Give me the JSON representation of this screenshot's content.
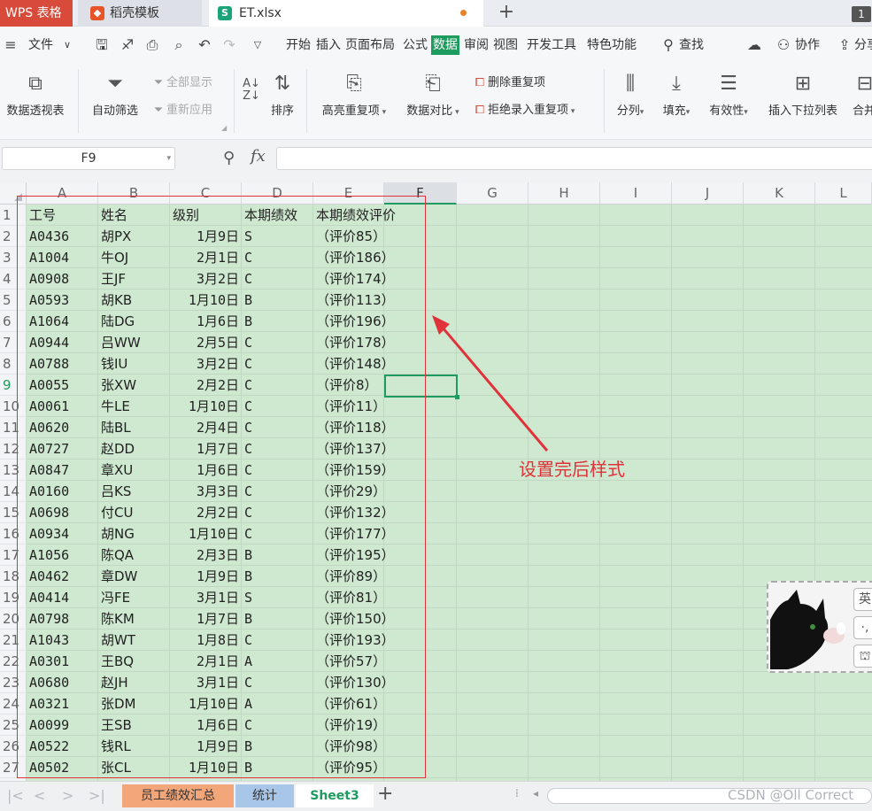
{
  "title_bar": {
    "wps_tab": "WPS 表格",
    "template_tab": "稻壳模板",
    "file_tab": "ET.xlsx",
    "window_count": "1"
  },
  "menu": {
    "file": "文件",
    "tabs": [
      "开始",
      "插入",
      "页面布局",
      "公式",
      "数据",
      "审阅",
      "视图",
      "开发工具",
      "特色功能"
    ],
    "active_tab": "数据",
    "search": "查找",
    "collab": "协作",
    "share": "分享"
  },
  "ribbon": {
    "pivot": "数据透视表",
    "autofilter": "自动筛选",
    "show_all": "全部显示",
    "reapply": "重新应用",
    "sort": "排序",
    "highlight_dup": "高亮重复项",
    "compare": "数据对比",
    "delete_dup": "删除重复项",
    "reject_dup": "拒绝录入重复项",
    "split": "分列",
    "fill": "填充",
    "validity": "有效性",
    "insert_dropdown": "插入下拉列表",
    "merge": "合并"
  },
  "formula_bar": {
    "name_box": "F9",
    "fx": "fx",
    "value": ""
  },
  "columns": [
    "A",
    "B",
    "C",
    "D",
    "E",
    "F",
    "G",
    "H",
    "I",
    "J",
    "K",
    "L"
  ],
  "selected_column": "F",
  "selected_row": "9",
  "sheet": {
    "headers": [
      "工号",
      "姓名",
      "级别",
      "本期绩效",
      "本期绩效评价"
    ],
    "rows": [
      [
        "A0436",
        "胡PX",
        "1月9日",
        "S",
        "（评价85）"
      ],
      [
        "A1004",
        "牛OJ",
        "2月1日",
        "C",
        "（评价186）"
      ],
      [
        "A0908",
        "王JF",
        "3月2日",
        "C",
        "（评价174）"
      ],
      [
        "A0593",
        "胡KB",
        "1月10日",
        "B",
        "（评价113）"
      ],
      [
        "A1064",
        "陆DG",
        "1月6日",
        "B",
        "（评价196）"
      ],
      [
        "A0944",
        "吕WW",
        "2月5日",
        "C",
        "（评价178）"
      ],
      [
        "A0788",
        "钱IU",
        "3月2日",
        "C",
        "（评价148）"
      ],
      [
        "A0055",
        "张XW",
        "2月2日",
        "C",
        "（评价8）"
      ],
      [
        "A0061",
        "牛LE",
        "1月10日",
        "C",
        "（评价11）"
      ],
      [
        "A0620",
        "陆BL",
        "2月4日",
        "C",
        "（评价118）"
      ],
      [
        "A0727",
        "赵DD",
        "1月7日",
        "C",
        "（评价137）"
      ],
      [
        "A0847",
        "章XU",
        "1月6日",
        "C",
        "（评价159）"
      ],
      [
        "A0160",
        "吕KS",
        "3月3日",
        "C",
        "（评价29）"
      ],
      [
        "A0698",
        "付CU",
        "2月2日",
        "C",
        "（评价132）"
      ],
      [
        "A0934",
        "胡NG",
        "1月10日",
        "C",
        "（评价177）"
      ],
      [
        "A1056",
        "陈QA",
        "2月3日",
        "B",
        "（评价195）"
      ],
      [
        "A0462",
        "章DW",
        "1月9日",
        "B",
        "（评价89）"
      ],
      [
        "A0414",
        "冯FE",
        "3月1日",
        "S",
        "（评价81）"
      ],
      [
        "A0798",
        "陈KM",
        "1月7日",
        "B",
        "（评价150）"
      ],
      [
        "A1043",
        "胡WT",
        "1月8日",
        "C",
        "（评价193）"
      ],
      [
        "A0301",
        "王BQ",
        "2月1日",
        "A",
        "（评价57）"
      ],
      [
        "A0680",
        "赵JH",
        "3月1日",
        "C",
        "（评价130）"
      ],
      [
        "A0321",
        "张DM",
        "1月10日",
        "A",
        "（评价61）"
      ],
      [
        "A0099",
        "王SB",
        "1月6日",
        "C",
        "（评价19）"
      ],
      [
        "A0522",
        "钱RL",
        "1月9日",
        "B",
        "（评价98）"
      ],
      [
        "A0502",
        "张CL",
        "1月10日",
        "B",
        "（评价95）"
      ]
    ]
  },
  "annotation": "设置完后样式",
  "widget": {
    "lang": "英",
    "punct": "·,",
    "skin": "shirt-icon"
  },
  "sheet_tabs": [
    "员工绩效汇总",
    "统计",
    "Sheet3"
  ],
  "active_sheet": "Sheet3",
  "watermark": "CSDN @Oll Correct",
  "colors": {
    "accent": "#1e9b5e",
    "cell_fill": "#cfe8d0",
    "annotation": "#e0323a",
    "tab_summary": "#f2a679",
    "tab_stats": "#a8c6e8"
  }
}
